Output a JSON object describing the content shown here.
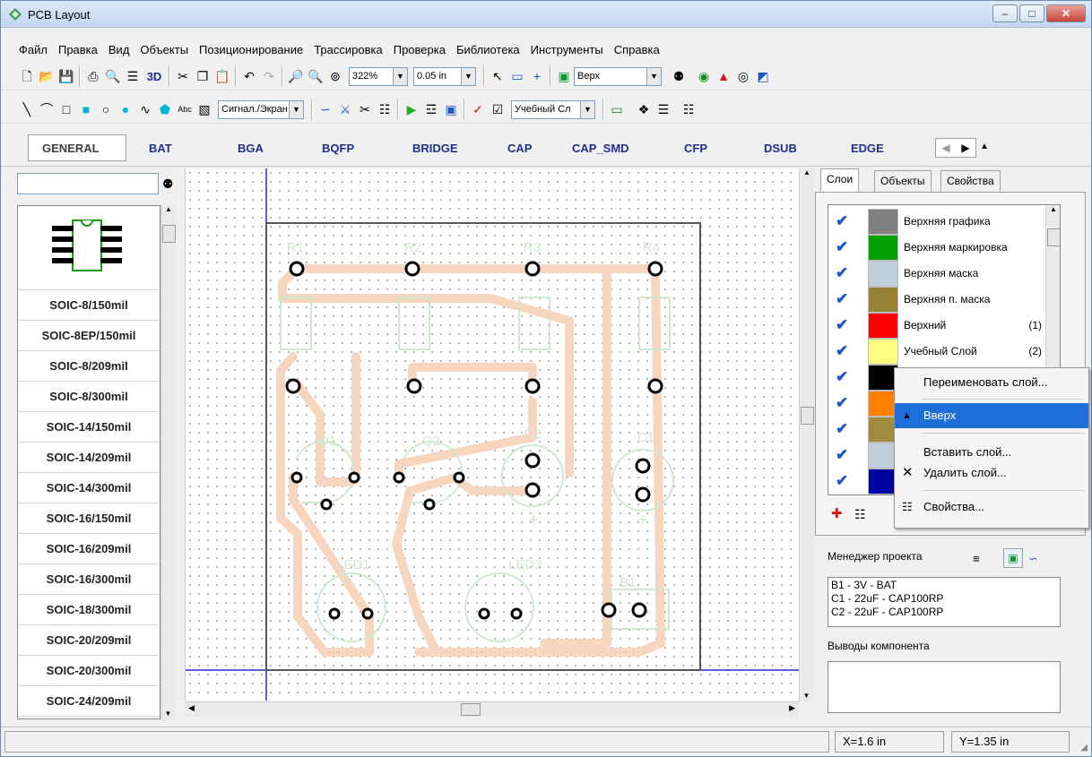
{
  "window": {
    "title": "PCB Layout"
  },
  "menu": [
    "Файл",
    "Правка",
    "Вид",
    "Объекты",
    "Позиционирование",
    "Трассировка",
    "Проверка",
    "Библиотека",
    "Инструменты",
    "Справка"
  ],
  "toolbar1": {
    "zoom": "322%",
    "grid": "0.05 in",
    "side": "Верх",
    "label_3d": "3D"
  },
  "toolbar2": {
    "layer_mode": "Сигнал./Экран",
    "active_layer": "Учебный Сл",
    "text_tool": "Abc"
  },
  "library_tabs": [
    "GENERAL",
    "BAT",
    "BGA",
    "BQFP",
    "BRIDGE",
    "CAP",
    "CAP_SMD",
    "CFP",
    "DSUB",
    "EDGE"
  ],
  "footprints": [
    "SOIC-8/150mil",
    "SOIC-8EP/150mil",
    "SOIC-8/209mil",
    "SOIC-8/300mil",
    "SOIC-14/150mil",
    "SOIC-14/209mil",
    "SOIC-14/300mil",
    "SOIC-16/150mil",
    "SOIC-16/209mil",
    "SOIC-16/300mil",
    "SOIC-18/300mil",
    "SOIC-20/209mil",
    "SOIC-20/300mil",
    "SOIC-24/209mil"
  ],
  "board": {
    "refs": [
      "R1",
      "R2",
      "R3",
      "R4",
      "Q1",
      "Q2",
      "C2",
      "C1",
      "LED1",
      "LED2",
      "B1"
    ],
    "plus": "+"
  },
  "right_tabs": [
    "Слои",
    "Объекты",
    "Свойства"
  ],
  "layers": [
    {
      "name": "Верхняя графика",
      "num": "",
      "color": "#808080"
    },
    {
      "name": "Верхняя маркировка",
      "num": "",
      "color": "#00a000"
    },
    {
      "name": "Верхняя маска",
      "num": "",
      "color": "#c0cfdb"
    },
    {
      "name": "Верхняя п. маска",
      "num": "",
      "color": "#968232"
    },
    {
      "name": "Верхний",
      "num": "(1)",
      "color": "#ff0000"
    },
    {
      "name": "Учебный Слой",
      "num": "(2)",
      "color": "#ffff80"
    },
    {
      "name": "",
      "num": "",
      "color": "#000000"
    },
    {
      "name": "",
      "num": "",
      "color": "#ff8000"
    },
    {
      "name": "",
      "num": "",
      "color": "#a08c3c"
    },
    {
      "name": "",
      "num": "",
      "color": "#c0cfdb"
    },
    {
      "name": "",
      "num": "",
      "color": "#0000a0"
    }
  ],
  "context_menu": [
    "Переименовать слой...",
    "Вверх",
    "Вставить слой...",
    "Удалить слой...",
    "Свойства..."
  ],
  "project_manager": {
    "label": "Менеджер проекта",
    "items": [
      "B1 - 3V - BAT",
      "C1 - 22uF - CAP100RP",
      "C2 - 22uF - CAP100RP"
    ]
  },
  "pins_label": "Выводы компонента",
  "status": {
    "x": "X=1.6 in",
    "y": "Y=1.35 in"
  },
  "colors": {
    "trace": "#f7d6bf",
    "silk": "#cfe8cf",
    "accent": "#1e6fd9",
    "check": "#1e56c8"
  }
}
